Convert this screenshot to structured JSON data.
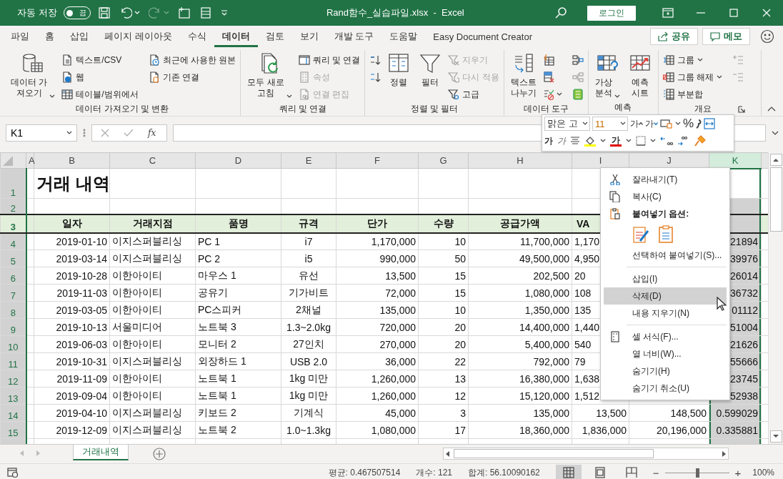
{
  "title_bar": {
    "autosave_label": "자동 저장",
    "autosave_toggle": {
      "label": "끔",
      "on": false
    },
    "redo_disabled": true,
    "title": "Rand함수_실습파일.xlsx  -  Excel",
    "signin_button": "로그인"
  },
  "ribbon_tabs": [
    {
      "label": "파일",
      "selected": false
    },
    {
      "label": "홈",
      "selected": false
    },
    {
      "label": "삽입",
      "selected": false
    },
    {
      "label": "페이지 레이아웃",
      "selected": false
    },
    {
      "label": "수식",
      "selected": false
    },
    {
      "label": "데이터",
      "selected": true
    },
    {
      "label": "검토",
      "selected": false
    },
    {
      "label": "보기",
      "selected": false
    },
    {
      "label": "개발 도구",
      "selected": false
    },
    {
      "label": "도움말",
      "selected": false
    },
    {
      "label": "Easy Document Creator",
      "selected": false
    }
  ],
  "share_button": "공유",
  "comment_button": "메모",
  "ribbon_groups": [
    {
      "label": "데이터 가져오기 및 변환",
      "items": [
        {
          "kind": "large",
          "lines": [
            "데이터 가",
            "져오기"
          ],
          "dropdown": true,
          "disabled": false
        },
        {
          "kind": "small",
          "label": "텍스트/CSV",
          "dropdown": false,
          "disabled": false
        },
        {
          "kind": "small",
          "label": "웹",
          "dropdown": false,
          "disabled": false
        },
        {
          "kind": "small",
          "label": "테이블/범위에서",
          "dropdown": false,
          "disabled": false
        },
        {
          "kind": "small",
          "label": "최근에 사용한 원본",
          "dropdown": false,
          "disabled": false
        },
        {
          "kind": "small",
          "label": "기존 연결",
          "dropdown": false,
          "disabled": false
        }
      ]
    },
    {
      "label": "쿼리 및 연결",
      "items": [
        {
          "kind": "large",
          "lines": [
            "모두 새로",
            "고침"
          ],
          "dropdown": true,
          "disabled": false
        },
        {
          "kind": "small",
          "label": "쿼리 및 연결",
          "dropdown": false,
          "disabled": false
        },
        {
          "kind": "small",
          "label": "속성",
          "dropdown": false,
          "disabled": true
        },
        {
          "kind": "small",
          "label": "연결 편집",
          "dropdown": false,
          "disabled": true
        }
      ]
    },
    {
      "label": "정렬 및 필터",
      "items": [
        {
          "kind": "icon",
          "dropdown": false,
          "disabled": false
        },
        {
          "kind": "icon",
          "dropdown": false,
          "disabled": false
        },
        {
          "kind": "large",
          "lines": [
            "정렬"
          ],
          "dropdown": false,
          "disabled": false
        },
        {
          "kind": "large",
          "lines": [
            "필터"
          ],
          "dropdown": false,
          "disabled": false
        },
        {
          "kind": "small",
          "label": "지우기",
          "dropdown": false,
          "disabled": true
        },
        {
          "kind": "small",
          "label": "다시 적용",
          "dropdown": false,
          "disabled": true
        },
        {
          "kind": "small",
          "label": "고급",
          "dropdown": false,
          "disabled": false
        }
      ]
    },
    {
      "label": "데이터 도구",
      "items": [
        {
          "kind": "large",
          "lines": [
            "텍스트",
            "나누기"
          ],
          "dropdown": false,
          "disabled": false
        },
        {
          "kind": "icon",
          "dropdown": false,
          "disabled": false
        },
        {
          "kind": "icon",
          "dropdown": false,
          "disabled": false
        },
        {
          "kind": "icon",
          "dropdown": true,
          "disabled": false
        },
        {
          "kind": "icon",
          "dropdown": false,
          "disabled": false
        },
        {
          "kind": "icon",
          "dropdown": false,
          "disabled": true
        },
        {
          "kind": "icon",
          "dropdown": false,
          "disabled": false
        }
      ]
    },
    {
      "label": "예측",
      "items": [
        {
          "kind": "large",
          "lines": [
            "가상",
            "분석"
          ],
          "dropdown": true,
          "disabled": false
        },
        {
          "kind": "large",
          "lines": [
            "예측",
            "시트"
          ],
          "dropdown": false,
          "disabled": false
        }
      ]
    },
    {
      "label": "개요",
      "items": [
        {
          "kind": "small",
          "label": "그룹",
          "dropdown": true,
          "disabled": false
        },
        {
          "kind": "small",
          "label": "그룹 해제",
          "dropdown": true,
          "disabled": false
        },
        {
          "kind": "small",
          "label": "부분합",
          "dropdown": false,
          "disabled": false
        },
        {
          "kind": "icon",
          "dropdown": false,
          "disabled": true
        },
        {
          "kind": "icon",
          "dropdown": false,
          "disabled": true
        }
      ]
    }
  ],
  "formula_bar": {
    "name_box": "K1",
    "function_button": "fx"
  },
  "mini_toolbar": {
    "font": "맑은 고",
    "size": "11",
    "grow_font": "가",
    "shrink_font": "가",
    "percent": "%",
    "bold": "가",
    "italic": "가",
    "font_color": "가"
  },
  "sheet": {
    "columns": [
      {
        "label": "A",
        "selected": false
      },
      {
        "label": "B",
        "selected": false
      },
      {
        "label": "C",
        "selected": false
      },
      {
        "label": "D",
        "selected": false
      },
      {
        "label": "E",
        "selected": false
      },
      {
        "label": "F",
        "selected": false
      },
      {
        "label": "G",
        "selected": false
      },
      {
        "label": "H",
        "selected": false
      },
      {
        "label": "I",
        "selected": false
      },
      {
        "label": "J",
        "selected": false
      },
      {
        "label": "K",
        "selected": true
      }
    ],
    "rows": [
      {
        "kind": "title",
        "number": "1",
        "cells": [
          null,
          "거래 내역",
          null,
          null,
          null,
          null,
          null,
          null,
          null,
          null,
          null
        ]
      },
      {
        "kind": "blank",
        "number": "2",
        "cells": [
          null,
          null,
          null,
          null,
          null,
          null,
          null,
          null,
          null,
          null,
          null
        ]
      },
      {
        "kind": "header",
        "number": "3",
        "cells": [
          null,
          "일자",
          "거래지점",
          "품명",
          "규격",
          "단가",
          "수량",
          "공급가액",
          "VA",
          null,
          null
        ]
      },
      {
        "kind": "data",
        "number": "4",
        "cells": [
          null,
          "2019-01-10",
          "이지스퍼블리싱",
          "PC 1",
          "i7",
          "1,170,000",
          "10",
          "11,700,000",
          "1,170",
          null,
          "21894"
        ]
      },
      {
        "kind": "data",
        "number": "5",
        "cells": [
          null,
          "2019-03-14",
          "이지스퍼블리싱",
          "PC 2",
          "i5",
          "990,000",
          "50",
          "49,500,000",
          "4,950",
          null,
          "39976"
        ]
      },
      {
        "kind": "data",
        "number": "6",
        "cells": [
          null,
          "2019-10-28",
          "이한아이티",
          "마우스 1",
          "유선",
          "13,500",
          "15",
          "202,500",
          "20",
          null,
          "26014"
        ]
      },
      {
        "kind": "data",
        "number": "7",
        "cells": [
          null,
          "2019-11-03",
          "이한아이티",
          "공유기",
          "기가비트",
          "72,000",
          "15",
          "1,080,000",
          "108",
          null,
          "36732"
        ]
      },
      {
        "kind": "data",
        "number": "8",
        "cells": [
          null,
          "2019-03-05",
          "이한아이티",
          "PC스피커",
          "2채널",
          "135,000",
          "10",
          "1,350,000",
          "135",
          null,
          "01112"
        ]
      },
      {
        "kind": "data",
        "number": "9",
        "cells": [
          null,
          "2019-10-13",
          "서울미디어",
          "노트북 3",
          "1.3~2.0kg",
          "720,000",
          "20",
          "14,400,000",
          "1,440",
          null,
          "51004"
        ]
      },
      {
        "kind": "data",
        "number": "10",
        "cells": [
          null,
          "2019-06-03",
          "이한아이티",
          "모니터 2",
          "27인치",
          "270,000",
          "20",
          "5,400,000",
          "540",
          null,
          "21626"
        ]
      },
      {
        "kind": "data",
        "number": "11",
        "cells": [
          null,
          "2019-10-31",
          "이지스퍼블리싱",
          "외장하드 1",
          "USB 2.0",
          "36,000",
          "22",
          "792,000",
          "79",
          null,
          "55666"
        ]
      },
      {
        "kind": "data",
        "number": "12",
        "cells": [
          null,
          "2019-11-09",
          "이한아이티",
          "노트북 1",
          "1kg 미만",
          "1,260,000",
          "13",
          "16,380,000",
          "1,638",
          null,
          "23745"
        ]
      },
      {
        "kind": "data",
        "number": "13",
        "cells": [
          null,
          "2019-09-04",
          "이한아이티",
          "노트북 1",
          "1kg 미만",
          "1,260,000",
          "12",
          "15,120,000",
          "1,512",
          null,
          "52938"
        ]
      },
      {
        "kind": "data",
        "number": "14",
        "cells": [
          null,
          "2019-04-10",
          "이지스퍼블리싱",
          "키보드 2",
          "기계식",
          "45,000",
          "3",
          "135,000",
          "13,500",
          "148,500",
          "0.599029"
        ]
      },
      {
        "kind": "data",
        "number": "15",
        "cells": [
          null,
          "2019-12-09",
          "이지스퍼블리싱",
          "노트북 2",
          "1.0~1.3kg",
          "1,080,000",
          "17",
          "18,360,000",
          "1,836,000",
          "20,196,000",
          "0.335881"
        ]
      },
      {
        "kind": "partial"
      }
    ]
  },
  "sheet_tabs": [
    {
      "label": "거래내역",
      "selected": true
    }
  ],
  "context_menu": [
    {
      "kind": "item",
      "label": "잘라내기(T)",
      "divider_before": false,
      "selected": false
    },
    {
      "kind": "item",
      "label": "복사(C)",
      "divider_before": false,
      "selected": false
    },
    {
      "kind": "heading",
      "label": "붙여넣기 옵션:",
      "divider_before": false,
      "selected": false
    },
    {
      "kind": "paste_icons",
      "divider_before": false,
      "selected": false
    },
    {
      "kind": "item",
      "label": "선택하여 붙여넣기(S)...",
      "divider_before": false,
      "selected": false
    },
    {
      "kind": "item",
      "label": "삽입(I)",
      "divider_before": true,
      "selected": false
    },
    {
      "kind": "item",
      "label": "삭제(D)",
      "divider_before": false,
      "selected": true
    },
    {
      "kind": "item",
      "label": "내용 지우기(N)",
      "divider_before": false,
      "selected": false
    },
    {
      "kind": "item",
      "label": "셀 서식(F)...",
      "divider_before": true,
      "selected": false
    },
    {
      "kind": "item",
      "label": "열 너비(W)...",
      "divider_before": false,
      "selected": false
    },
    {
      "kind": "item",
      "label": "숨기기(H)",
      "divider_before": false,
      "selected": false
    },
    {
      "kind": "item",
      "label": "숨기기 취소(U)",
      "divider_before": false,
      "selected": false
    }
  ],
  "status_bar": {
    "average": "평균: 0.467507514",
    "count": "개수: 121",
    "sum": "합계: 56.10090162",
    "views": [
      {
        "selected": true
      },
      {
        "selected": false
      },
      {
        "selected": false
      }
    ],
    "zoom_out": "−",
    "zoom": {
      "level": 0.5
    },
    "zoom_in": "+",
    "zoom_label": "100%"
  }
}
